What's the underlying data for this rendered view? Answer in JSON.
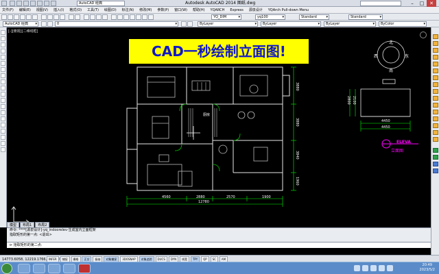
{
  "window": {
    "workspace": "AutoCAD 经典",
    "title": "Autodesk AutoCAD 2014  图纸.dwg",
    "search_placeholder": "",
    "min": "–",
    "max": "□",
    "close": "✕"
  },
  "menu": [
    "文件(F)",
    "编辑(E)",
    "视图(V)",
    "插入(I)",
    "格式(O)",
    "工具(T)",
    "绘图(D)",
    "标注(N)",
    "修改(M)",
    "参数(P)",
    "窗口(W)",
    "帮助(H)",
    "YQARCH",
    "Express",
    "源泉设计",
    "YQArch Pull-down Menu"
  ],
  "toolbar": {
    "workspace_combo": "AutoCAD 经典",
    "layer_combo": "0",
    "color_combo": "ByLayer",
    "linetype_combo": "ByLayer",
    "lineweight_combo": "ByLayer",
    "plotstyle_combo": "ByColor",
    "dimstyle_combo": "YQ_DIM",
    "textstyle_combo": "yq100",
    "tablestyle_combo": "Standard",
    "mleader_combo": "Standard"
  },
  "canvas": {
    "viewport_label": "[-][俯视][二维线框]",
    "banner": "CAD一秒绘制立面图!",
    "dims_top_total": "12780",
    "dims_top": [
      "4560",
      "2880",
      "2570",
      "1900"
    ],
    "dims_right": [
      "3880",
      "3880",
      "3840",
      "1960"
    ],
    "elev_dims": [
      "4450",
      "4450",
      "2800",
      "2100"
    ],
    "elev_label": "ELEVA",
    "elev_sublabel": "立面图",
    "compass": {
      "n": "北",
      "s": "南",
      "w": "西",
      "e": "东"
    },
    "room_label": "厨房"
  },
  "layout_tabs": [
    "模型",
    "布局1",
    "布局2"
  ],
  "command": {
    "history1": "命令: ****[源泉设计]-yq_indoorelev-生成室内立面框架",
    "history2": "  指取矩形的第一点: <退出>",
    "prompt": "⊳ 拾取矩形的第二点:"
  },
  "status": {
    "coords": "14773.6058, 12219.1766, 0.0000",
    "buttons": [
      "INFER",
      "捕捉",
      "栅格",
      "正交",
      "极轴",
      "对象捕捉",
      "3DOSNAP",
      "对象追踪",
      "DUCS",
      "DYN",
      "线宽",
      "TPY",
      "QP",
      "SC",
      "AM"
    ],
    "on_flags": [
      false,
      false,
      false,
      true,
      false,
      true,
      false,
      true,
      false,
      false,
      false,
      true,
      false,
      false,
      false
    ]
  },
  "taskbar": {
    "time": "20:49",
    "date": "2023/5/2"
  }
}
